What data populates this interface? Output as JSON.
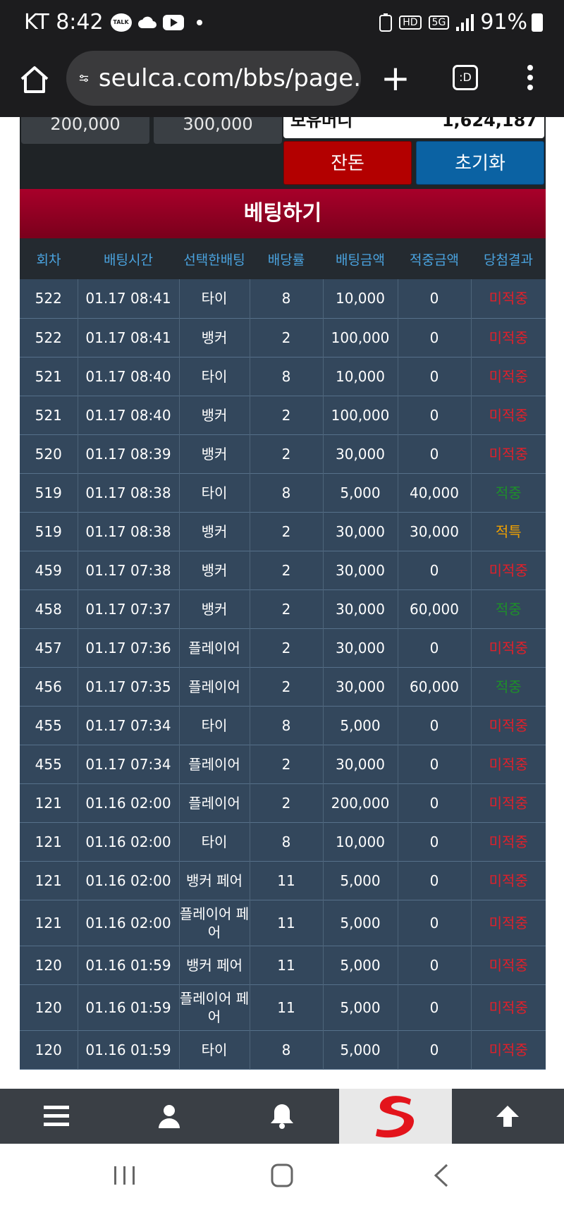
{
  "status_bar": {
    "carrier_time": "KT 8:42",
    "talk_icon_label": "TALK",
    "hd_label": "HD",
    "network_label": "5G",
    "battery": "91%"
  },
  "browser": {
    "url": "seulca.com/bbs/page.",
    "tab_label": ":D"
  },
  "top_panel": {
    "chip1": "200,000",
    "chip2": "300,000",
    "holding_label": "보유머니",
    "holding_value": "1,624,187",
    "balance_button": "잔돈",
    "reset_button": "초기화"
  },
  "section_title": "베팅하기",
  "table": {
    "headers": [
      "회차",
      "배팅시간",
      "선택한배팅",
      "배당률",
      "배팅금액",
      "적중금액",
      "당첨결과"
    ],
    "rows": [
      [
        "522",
        "01.17 08:41",
        "타이",
        "8",
        "10,000",
        "0",
        "미적중"
      ],
      [
        "522",
        "01.17 08:41",
        "뱅커",
        "2",
        "100,000",
        "0",
        "미적중"
      ],
      [
        "521",
        "01.17 08:40",
        "타이",
        "8",
        "10,000",
        "0",
        "미적중"
      ],
      [
        "521",
        "01.17 08:40",
        "뱅커",
        "2",
        "100,000",
        "0",
        "미적중"
      ],
      [
        "520",
        "01.17 08:39",
        "뱅커",
        "2",
        "30,000",
        "0",
        "미적중"
      ],
      [
        "519",
        "01.17 08:38",
        "타이",
        "8",
        "5,000",
        "40,000",
        "적중"
      ],
      [
        "519",
        "01.17 08:38",
        "뱅커",
        "2",
        "30,000",
        "30,000",
        "적특"
      ],
      [
        "459",
        "01.17 07:38",
        "뱅커",
        "2",
        "30,000",
        "0",
        "미적중"
      ],
      [
        "458",
        "01.17 07:37",
        "뱅커",
        "2",
        "30,000",
        "60,000",
        "적중"
      ],
      [
        "457",
        "01.17 07:36",
        "플레이어",
        "2",
        "30,000",
        "0",
        "미적중"
      ],
      [
        "456",
        "01.17 07:35",
        "플레이어",
        "2",
        "30,000",
        "60,000",
        "적중"
      ],
      [
        "455",
        "01.17 07:34",
        "타이",
        "8",
        "5,000",
        "0",
        "미적중"
      ],
      [
        "455",
        "01.17 07:34",
        "플레이어",
        "2",
        "30,000",
        "0",
        "미적중"
      ],
      [
        "121",
        "01.16 02:00",
        "플레이어",
        "2",
        "200,000",
        "0",
        "미적중"
      ],
      [
        "121",
        "01.16 02:00",
        "타이",
        "8",
        "10,000",
        "0",
        "미적중"
      ],
      [
        "121",
        "01.16 02:00",
        "뱅커 페어",
        "11",
        "5,000",
        "0",
        "미적중"
      ],
      [
        "121",
        "01.16 02:00",
        "플레이어 페어",
        "11",
        "5,000",
        "0",
        "미적중"
      ],
      [
        "120",
        "01.16 01:59",
        "뱅커 페어",
        "11",
        "5,000",
        "0",
        "미적중"
      ],
      [
        "120",
        "01.16 01:59",
        "플레이어 페어",
        "11",
        "5,000",
        "0",
        "미적중"
      ],
      [
        "120",
        "01.16 01:59",
        "타이",
        "8",
        "5,000",
        "0",
        "미적중"
      ]
    ]
  },
  "colors": {
    "lose": "#e0202a",
    "win": "#1e8f2a",
    "special": "#f0a000",
    "header_text": "#4aa3df",
    "row_bg": "#33475c"
  },
  "bottom_nav": {
    "icons": [
      "menu-icon",
      "user-icon",
      "bell-icon",
      "logo-s",
      "arrow-up-icon"
    ]
  }
}
